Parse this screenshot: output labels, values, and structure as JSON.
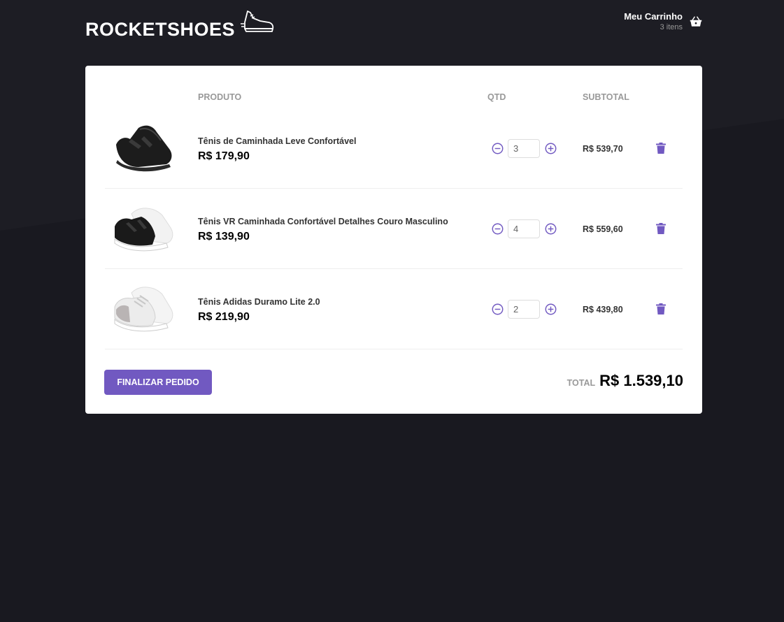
{
  "header": {
    "logo_text": "ROCKETSHOES",
    "cart_title": "Meu Carrinho",
    "cart_count": "3 itens"
  },
  "table": {
    "col_produto": "PRODUTO",
    "col_qtd": "QTD",
    "col_subtotal": "SUBTOTAL"
  },
  "items": [
    {
      "name": "Tênis de Caminhada Leve Confortável",
      "price": "R$ 179,90",
      "qty": "3",
      "subtotal": "R$ 539,70",
      "shoe_color": "black"
    },
    {
      "name": "Tênis VR Caminhada Confortável Detalhes Couro Masculino",
      "price": "R$ 139,90",
      "qty": "4",
      "subtotal": "R$ 559,60",
      "shoe_color": "black-white"
    },
    {
      "name": "Tênis Adidas Duramo Lite 2.0",
      "price": "R$ 219,90",
      "qty": "2",
      "subtotal": "R$ 439,80",
      "shoe_color": "white"
    }
  ],
  "footer": {
    "finalize_label": "FINALIZAR PEDIDO",
    "total_label": "TOTAL",
    "total_value": "R$ 1.539,10"
  },
  "colors": {
    "accent": "#7159c1",
    "background": "#191920"
  }
}
